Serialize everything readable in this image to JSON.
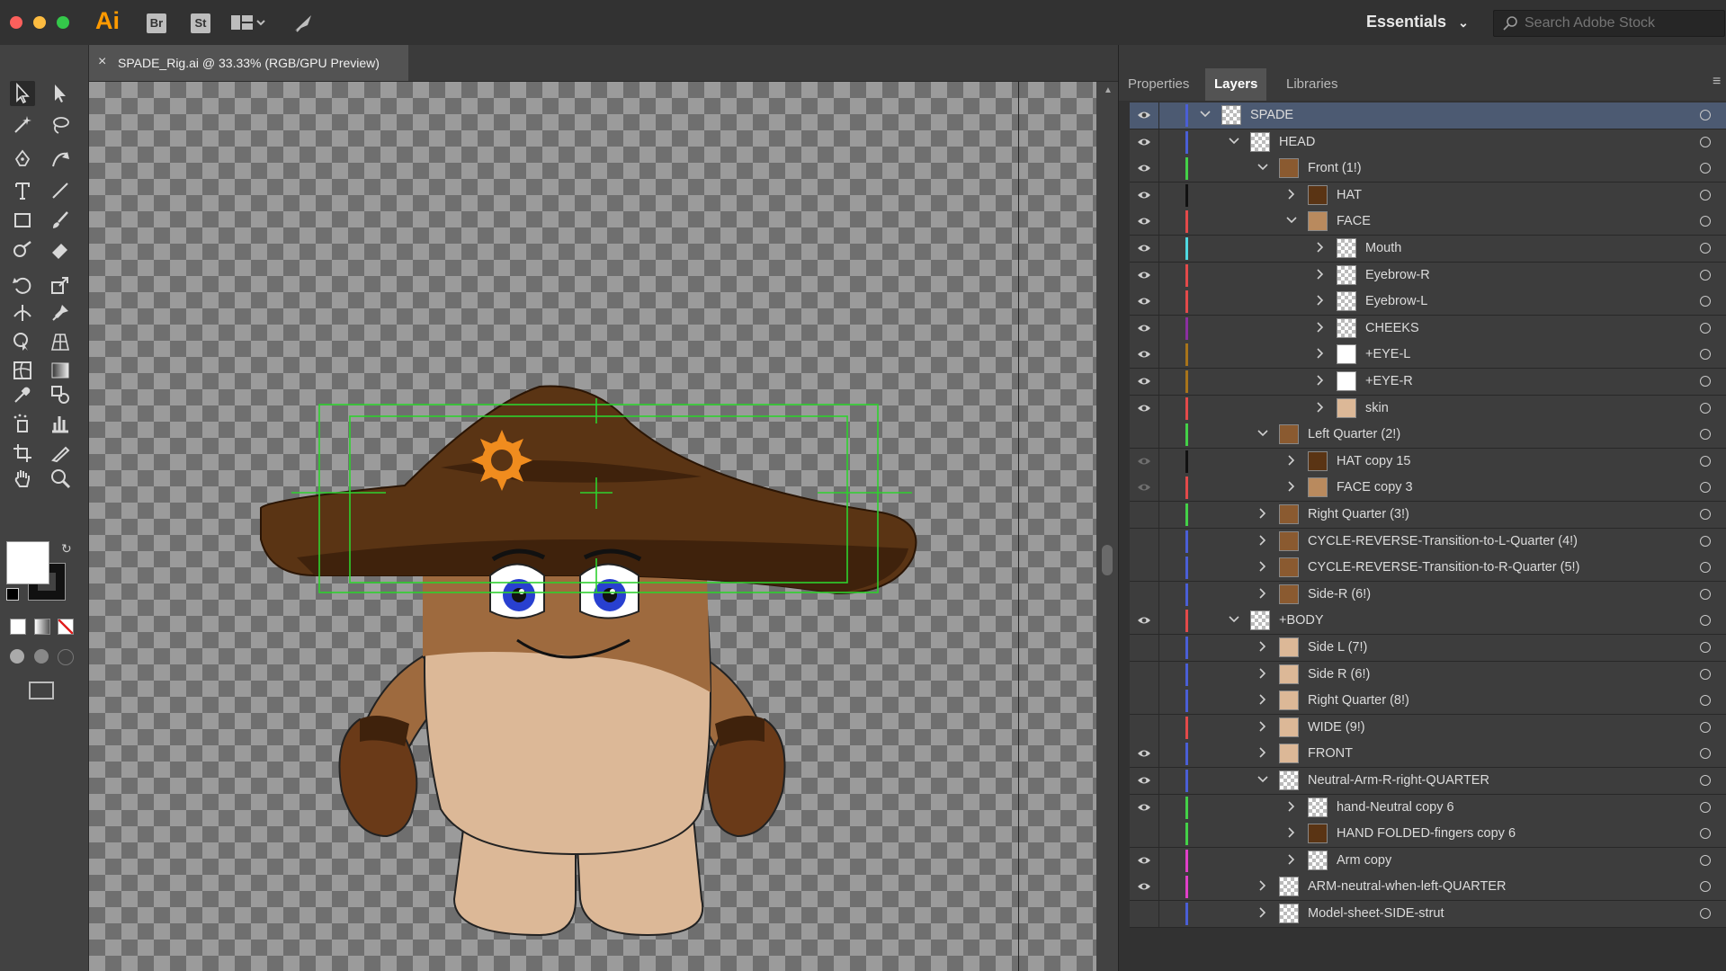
{
  "app": {
    "logo_text": "Ai",
    "bridge_label": "Br",
    "stock_label": "St",
    "workspace_label": "Essentials",
    "search_placeholder": "Search Adobe Stock"
  },
  "document": {
    "tab_title": "SPADE_Rig.ai @ 33.33% (RGB/GPU Preview)",
    "close_glyph": "×"
  },
  "panel": {
    "tabs": [
      "Properties",
      "Layers",
      "Libraries"
    ],
    "active_tab": "Layers"
  },
  "layers": [
    {
      "name": "SPADE",
      "depth": 0,
      "expanded": true,
      "has_children": true,
      "visible": true,
      "color": "#4a5fd6",
      "selected": true,
      "thumb": "checker"
    },
    {
      "name": "HEAD",
      "depth": 1,
      "expanded": true,
      "has_children": true,
      "visible": true,
      "color": "#4a5fd6",
      "thumb": "checker"
    },
    {
      "name": "Front (1!)",
      "depth": 2,
      "expanded": true,
      "has_children": true,
      "visible": true,
      "color": "#44d148",
      "thumb": "char"
    },
    {
      "name": "HAT",
      "depth": 3,
      "expanded": false,
      "has_children": true,
      "visible": true,
      "color": "#111111",
      "thumb": "hat"
    },
    {
      "name": "FACE",
      "depth": 3,
      "expanded": true,
      "has_children": true,
      "visible": true,
      "color": "#e34a4a",
      "thumb": "face"
    },
    {
      "name": "Mouth",
      "depth": 4,
      "expanded": false,
      "has_children": true,
      "visible": true,
      "color": "#4fd8e0",
      "thumb": "checker"
    },
    {
      "name": "Eyebrow-R",
      "depth": 4,
      "expanded": false,
      "has_children": true,
      "visible": true,
      "color": "#e34a4a",
      "thumb": "checker"
    },
    {
      "name": "Eyebrow-L",
      "depth": 4,
      "expanded": false,
      "has_children": true,
      "visible": true,
      "color": "#e34a4a",
      "thumb": "checker"
    },
    {
      "name": "CHEEKS",
      "depth": 4,
      "expanded": false,
      "has_children": true,
      "visible": true,
      "color": "#8b2fa0",
      "thumb": "checker"
    },
    {
      "name": "+EYE-L",
      "depth": 4,
      "expanded": false,
      "has_children": true,
      "visible": true,
      "color": "#a8741a",
      "thumb": "eye"
    },
    {
      "name": "+EYE-R",
      "depth": 4,
      "expanded": false,
      "has_children": true,
      "visible": true,
      "color": "#a8741a",
      "thumb": "eye"
    },
    {
      "name": "skin",
      "depth": 4,
      "expanded": false,
      "has_children": true,
      "visible": true,
      "color": "#e34a4a",
      "thumb": "skin"
    },
    {
      "name": "Left Quarter (2!)",
      "depth": 2,
      "expanded": true,
      "has_children": true,
      "visible": false,
      "color": "#44d148",
      "thumb": "char"
    },
    {
      "name": "HAT copy 15",
      "depth": 3,
      "expanded": false,
      "has_children": true,
      "visible": "dim",
      "color": "#111111",
      "thumb": "hat"
    },
    {
      "name": "FACE copy 3",
      "depth": 3,
      "expanded": false,
      "has_children": true,
      "visible": "dim",
      "color": "#e34a4a",
      "thumb": "face"
    },
    {
      "name": "Right Quarter (3!)",
      "depth": 2,
      "expanded": false,
      "has_children": true,
      "visible": false,
      "color": "#44d148",
      "thumb": "char"
    },
    {
      "name": "CYCLE-REVERSE-Transition-to-L-Quarter (4!)",
      "depth": 2,
      "expanded": false,
      "has_children": true,
      "visible": false,
      "color": "#4a5fd6",
      "thumb": "char"
    },
    {
      "name": "CYCLE-REVERSE-Transition-to-R-Quarter (5!)",
      "depth": 2,
      "expanded": false,
      "has_children": true,
      "visible": false,
      "color": "#4a5fd6",
      "thumb": "char"
    },
    {
      "name": "Side-R (6!)",
      "depth": 2,
      "expanded": false,
      "has_children": true,
      "visible": false,
      "color": "#4a5fd6",
      "thumb": "char"
    },
    {
      "name": "+BODY",
      "depth": 1,
      "expanded": true,
      "has_children": true,
      "visible": true,
      "color": "#e34a4a",
      "thumb": "checker"
    },
    {
      "name": "Side L (7!)",
      "depth": 2,
      "expanded": false,
      "has_children": true,
      "visible": false,
      "color": "#4a5fd6",
      "thumb": "skin"
    },
    {
      "name": "Side R (6!)",
      "depth": 2,
      "expanded": false,
      "has_children": true,
      "visible": false,
      "color": "#4a5fd6",
      "thumb": "skin"
    },
    {
      "name": "Right Quarter (8!)",
      "depth": 2,
      "expanded": false,
      "has_children": true,
      "visible": false,
      "color": "#4a5fd6",
      "thumb": "skin"
    },
    {
      "name": "WIDE (9!)",
      "depth": 2,
      "expanded": false,
      "has_children": true,
      "visible": false,
      "color": "#e34a4a",
      "thumb": "skin"
    },
    {
      "name": "FRONT",
      "depth": 2,
      "expanded": false,
      "has_children": true,
      "visible": true,
      "color": "#4a5fd6",
      "thumb": "skin"
    },
    {
      "name": "Neutral-Arm-R-right-QUARTER",
      "depth": 2,
      "expanded": true,
      "has_children": true,
      "visible": true,
      "color": "#4a5fd6",
      "thumb": "checker"
    },
    {
      "name": "hand-Neutral copy 6",
      "depth": 3,
      "expanded": false,
      "has_children": true,
      "visible": true,
      "color": "#44d148",
      "thumb": "checker"
    },
    {
      "name": "HAND FOLDED-fingers copy 6",
      "depth": 3,
      "expanded": false,
      "has_children": true,
      "visible": false,
      "color": "#44d148",
      "thumb": "hand"
    },
    {
      "name": "Arm copy",
      "depth": 3,
      "expanded": false,
      "has_children": true,
      "visible": true,
      "color": "#e040c8",
      "thumb": "checker"
    },
    {
      "name": "ARM-neutral-when-left-QUARTER",
      "depth": 2,
      "expanded": false,
      "has_children": true,
      "visible": true,
      "color": "#e040c8",
      "thumb": "checker"
    },
    {
      "name": "Model-sheet-SIDE-strut",
      "depth": 2,
      "expanded": false,
      "has_children": true,
      "visible": false,
      "color": "#4a5fd6",
      "thumb": "checker"
    }
  ],
  "colors": {
    "hat_brown": "#5a3414",
    "hat_dark": "#3f220c",
    "skin": "#dcb897",
    "skin_dark": "#9e6a3e",
    "sun": "#f08c1e",
    "eye_blue": "#2840d0",
    "selection_green": "#2ed12e"
  }
}
